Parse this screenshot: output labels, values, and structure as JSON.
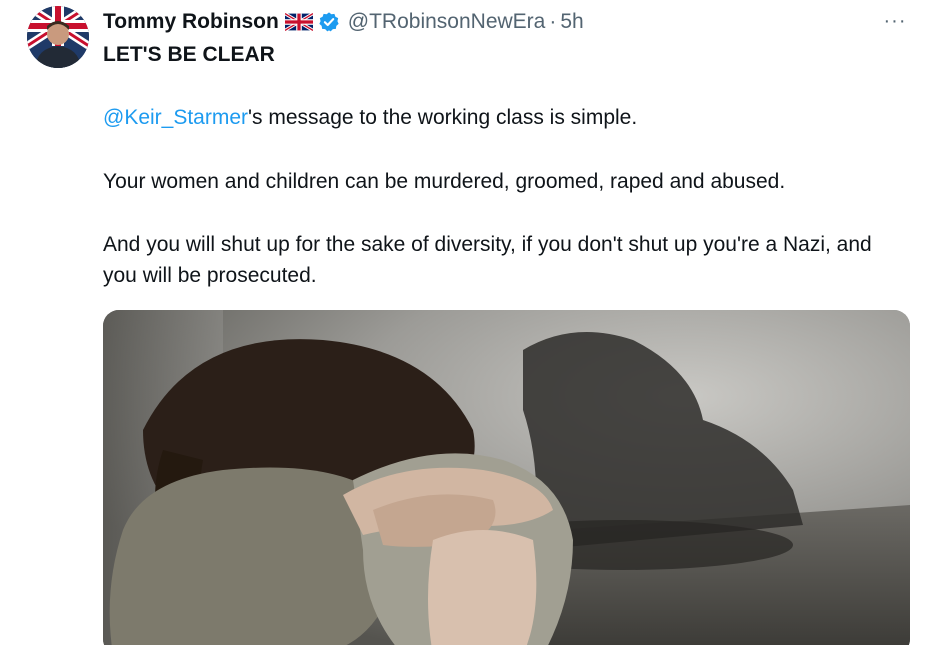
{
  "tweet": {
    "author": {
      "display_name": "Tommy Robinson",
      "handle": "@TRobinsonNewEra",
      "flag_icon": "uk-flag-icon",
      "verified_icon": "verified-badge-icon",
      "verified_color": "#1d9bf0"
    },
    "separator": "·",
    "time": "5h",
    "more_icon": "more-horizontal-icon",
    "more_label": "···",
    "headline": "LET'S BE CLEAR",
    "paragraphs": {
      "p1_mention": "@Keir_Starmer",
      "p1_rest": "'s message to the working class is simple.",
      "p2": "Your women and children can be murdered, groomed, raped and abused.",
      "p3": "And you will shut up for the sake of diversity, if you don't shut up you're a Nazi, and you will be prosecuted."
    },
    "media": {
      "description_icon": "photo-image"
    },
    "colors": {
      "link": "#1d9bf0",
      "secondary_text": "#536471",
      "primary_text": "#0f1419"
    }
  }
}
